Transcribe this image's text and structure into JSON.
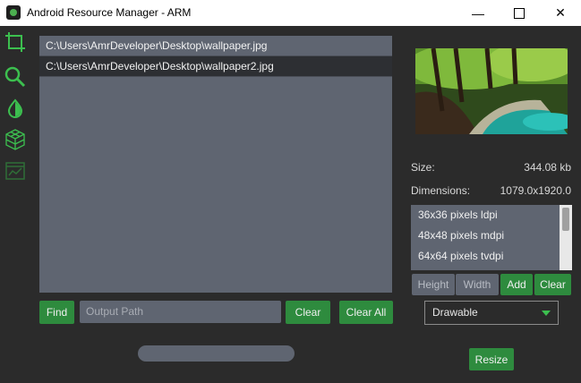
{
  "window": {
    "title": "Android Resource Manager - ARM",
    "minimize": "—",
    "close": "✕"
  },
  "sidebar": {
    "items": [
      {
        "icon": "crop-icon"
      },
      {
        "icon": "search-icon"
      },
      {
        "icon": "drop-icon"
      },
      {
        "icon": "cube-icon"
      },
      {
        "icon": "chart-icon"
      }
    ]
  },
  "files": [
    "C:\\Users\\AmrDeveloper\\Desktop\\wallpaper.jpg",
    "C:\\Users\\AmrDeveloper\\Desktop\\wallpaper2.jpg"
  ],
  "actions": {
    "find": "Find",
    "output_placeholder": "Output Path",
    "clear": "Clear",
    "clear_all": "Clear All"
  },
  "info": {
    "size_label": "Size:",
    "size_value": "344.08 kb",
    "dimensions_label": "Dimensions:",
    "dimensions_value": "1079.0x1920.0"
  },
  "sizes": [
    "36x36 pixels ldpi",
    "48x48 pixels mdpi",
    "64x64 pixels tvdpi"
  ],
  "size_controls": {
    "height": "Height",
    "width": "Width",
    "add": "Add",
    "clear": "Clear"
  },
  "resource_type": {
    "selected": "Drawable"
  },
  "resize": "Resize",
  "colors": {
    "accent": "#2e8b3e",
    "icon_green": "#3cbf4f",
    "panel": "#5f6571",
    "background": "#2b2b2b"
  }
}
